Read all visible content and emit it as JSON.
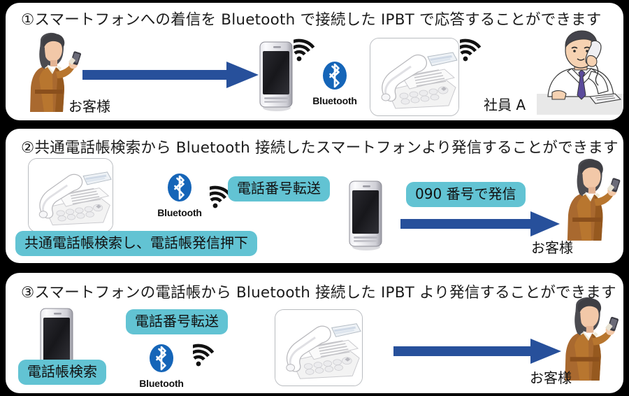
{
  "document": {
    "title": "Bluetooth IPBT スマートフォン連携 機能説明図",
    "background_color": "#000000",
    "panel_background": "#ffffff",
    "accent_arrow_color": "#27509B",
    "tag_color": "#62c3d3",
    "bluetooth_blue": "#1565B8"
  },
  "panels": [
    {
      "id": "panel-1",
      "number": "①",
      "title": "①スマートフォンへの着信を Bluetooth で接続した IPBT で応答することができます",
      "captions": {
        "customer": "お客様",
        "employee": "社員 A"
      },
      "icons": {
        "bluetooth_label": "Bluetooth",
        "wifi_left": "wifi-signal-icon",
        "wifi_right": "wifi-signal-icon",
        "arrow": "right-arrow"
      },
      "figures": {
        "person_left": "customer-woman-with-smartphone",
        "smartphone": "smartphone-device",
        "desk_phone": "ipbt-desk-phone",
        "person_right": "employee-man-on-desk-phone"
      }
    },
    {
      "id": "panel-2",
      "number": "②",
      "title": "②共通電話帳検索から Bluetooth 接続したスマートフォンより発信することができます",
      "tags": [
        {
          "name": "tag-phone-number-transfer",
          "text": "電話番号転送"
        },
        {
          "name": "tag-090-call",
          "text": "090 番号で発信"
        },
        {
          "name": "tag-common-directory-search",
          "text": "共通電話帳検索し、電話帳発信押下"
        }
      ],
      "captions": {
        "customer": "お客様"
      },
      "icons": {
        "bluetooth_label": "Bluetooth",
        "wifi": "wifi-signal-icon",
        "arrow": "right-arrow"
      },
      "figures": {
        "desk_phone": "ipbt-desk-phone",
        "smartphone": "smartphone-device",
        "person_right": "customer-woman-with-smartphone"
      }
    },
    {
      "id": "panel-3",
      "number": "③",
      "title": "③スマートフォンの電話帳から Bluetooth 接続した IPBT より発信することができます",
      "tags": [
        {
          "name": "tag-phone-number-transfer",
          "text": "電話番号転送"
        },
        {
          "name": "tag-directory-search",
          "text": "電話帳検索"
        }
      ],
      "captions": {
        "customer": "お客様"
      },
      "icons": {
        "bluetooth_label": "Bluetooth",
        "wifi": "wifi-signal-icon",
        "arrow": "right-arrow"
      },
      "figures": {
        "smartphone": "smartphone-device",
        "desk_phone": "ipbt-desk-phone",
        "person_right": "customer-woman-with-smartphone"
      }
    }
  ]
}
